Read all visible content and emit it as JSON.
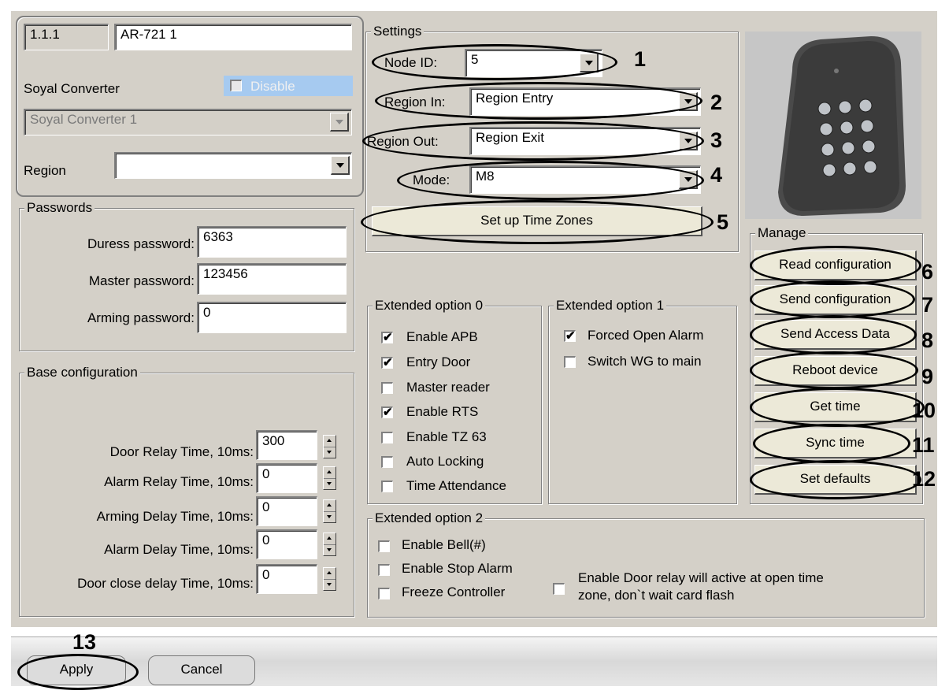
{
  "device": {
    "address": "1.1.1",
    "name": "AR-721 1",
    "type_label": "Soyal Converter",
    "disable_label": "Disable",
    "converter_value": "Soyal Converter 1",
    "region_label": "Region",
    "region_value": ""
  },
  "passwords": {
    "title": "Passwords",
    "duress_label": "Duress password:",
    "duress_value": "6363",
    "master_label": "Master password:",
    "master_value": "123456",
    "arming_label": "Arming password:",
    "arming_value": "0"
  },
  "base": {
    "title": "Base configuration",
    "rows": [
      {
        "label": "Door Relay Time, 10ms:",
        "value": "300"
      },
      {
        "label": "Alarm Relay Time, 10ms:",
        "value": "0"
      },
      {
        "label": "Arming Delay Time, 10ms:",
        "value": "0"
      },
      {
        "label": "Alarm Delay Time, 10ms:",
        "value": "0"
      },
      {
        "label": "Door close delay Time, 10ms:",
        "value": "0"
      }
    ]
  },
  "settings": {
    "title": "Settings",
    "node_label": "Node ID:",
    "node_value": "5",
    "region_in_label": "Region In:",
    "region_in_value": "Region Entry",
    "region_out_label": "Region Out:",
    "region_out_value": "Region Exit",
    "mode_label": "Mode:",
    "mode_value": "M8",
    "timezones_label": "Set up Time Zones"
  },
  "ext0": {
    "title": "Extended option 0",
    "items": [
      {
        "label": "Enable APB",
        "checked": true
      },
      {
        "label": "Entry Door",
        "checked": true
      },
      {
        "label": "Master reader",
        "checked": false
      },
      {
        "label": "Enable RTS",
        "checked": true
      },
      {
        "label": "Enable TZ 63",
        "checked": false
      },
      {
        "label": "Auto Locking",
        "checked": false
      },
      {
        "label": "Time Attendance",
        "checked": false
      }
    ]
  },
  "ext1": {
    "title": "Extended option 1",
    "items": [
      {
        "label": "Forced Open Alarm",
        "checked": true
      },
      {
        "label": "Switch WG to main",
        "checked": false
      }
    ]
  },
  "ext2": {
    "title": "Extended option 2",
    "items": [
      {
        "label": "Enable Bell(#)",
        "checked": false
      },
      {
        "label": "Enable Stop Alarm",
        "checked": false
      },
      {
        "label": "Freeze Controller",
        "checked": false
      }
    ],
    "door_relay_line1": "Enable Door relay will active at open time",
    "door_relay_line2": "zone, don`t wait card flash"
  },
  "manage": {
    "title": "Manage",
    "buttons": [
      "Read configuration",
      "Send configuration",
      "Send Access Data",
      "Reboot device",
      "Get time",
      "Sync time",
      "Set defaults"
    ]
  },
  "footer": {
    "apply": "Apply",
    "cancel": "Cancel"
  },
  "callouts": [
    "1",
    "2",
    "3",
    "4",
    "5",
    "6",
    "7",
    "8",
    "9",
    "10",
    "11",
    "12",
    "13"
  ],
  "check_mark": "✔"
}
